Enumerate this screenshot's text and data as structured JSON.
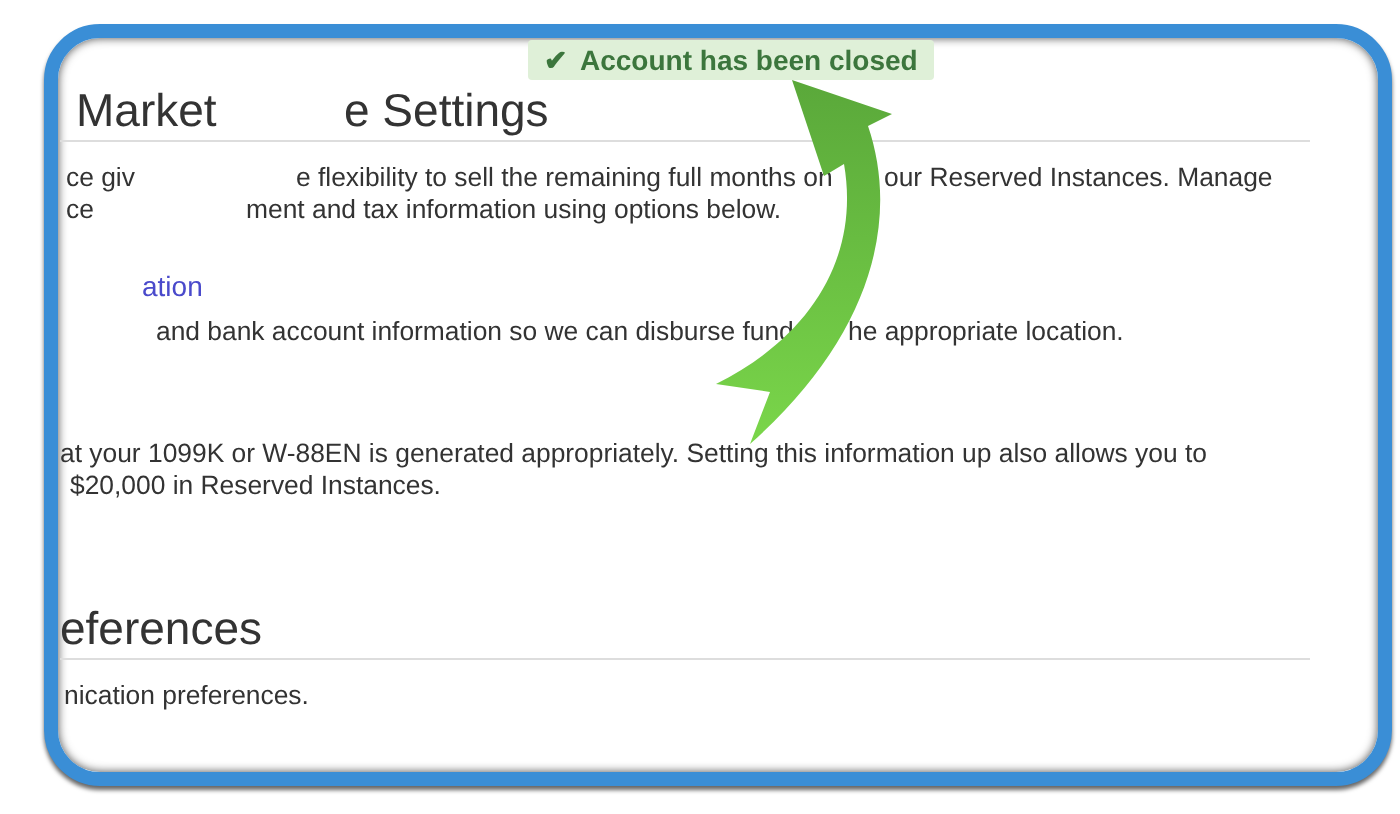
{
  "notification": {
    "icon": "✔",
    "text": "Account has been closed"
  },
  "rows": [
    {
      "kind": "heading",
      "parts": [
        "Market",
        "e Settings"
      ]
    },
    {
      "kind": "text",
      "parts": [
        "ce giv",
        "e flexibility to sell the remaining full months on",
        "our Reserved Instances. Manage"
      ]
    },
    {
      "kind": "text",
      "parts": [
        "ce",
        "ment and tax information using options below."
      ]
    },
    {
      "kind": "link",
      "parts": [
        "ation"
      ]
    },
    {
      "kind": "text",
      "parts": [
        "and bank account information so we can disburse fund",
        "he appropriate location."
      ]
    },
    {
      "kind": "text",
      "parts": [
        "at your 1099K or W-88EN is generated appropriately. Setting this information up also allows you to"
      ]
    },
    {
      "kind": "text",
      "parts": [
        "$20,000 in Reserved Instances."
      ]
    },
    {
      "kind": "heading",
      "parts": [
        "eferences"
      ]
    },
    {
      "kind": "text",
      "parts": [
        "nication preferences."
      ]
    }
  ]
}
